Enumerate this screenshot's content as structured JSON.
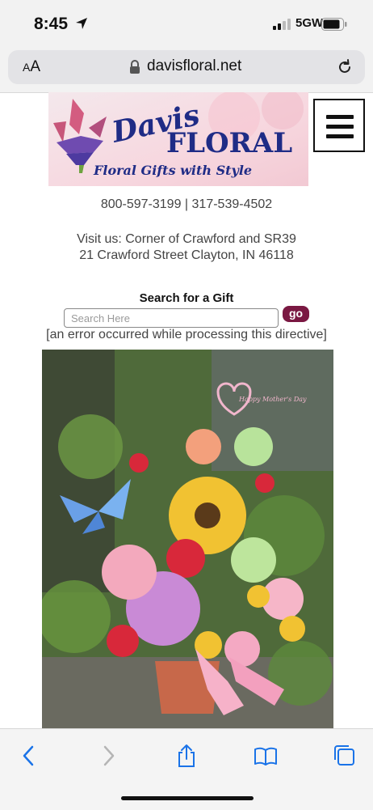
{
  "status_bar": {
    "time": "8:45",
    "network": "5GW"
  },
  "browser": {
    "text_size_label_small": "A",
    "text_size_label_large": "A",
    "url": "davisfloral.net"
  },
  "logo": {
    "name_line1": "Davis",
    "name_line2": "FLORAL",
    "tagline": "Floral Gifts with Style"
  },
  "contact": {
    "phones": "800-597-3199 | 317-539-4502",
    "visit_line1": "Visit us: Corner of Crawford and SR39",
    "visit_line2": "21 Crawford Street Clayton, IN 46118"
  },
  "search": {
    "label": "Search for a Gift",
    "placeholder": "Search Here",
    "button": "go"
  },
  "error_message": "[an error occurred while processing this directive]",
  "hero": {
    "sign_text": "Happy Mother's Day"
  },
  "colors": {
    "accent": "#7a1842",
    "link_blue": "#1a73e8",
    "logo_navy": "#1f2c86"
  }
}
